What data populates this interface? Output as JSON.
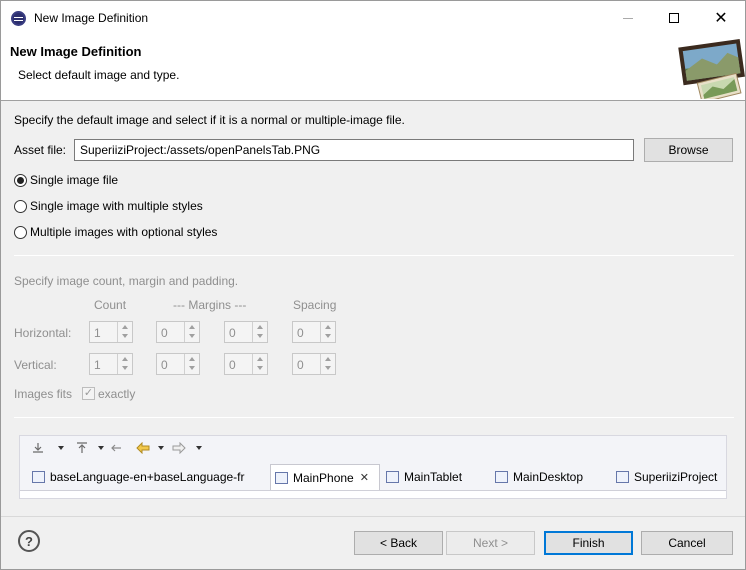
{
  "window": {
    "title": "New Image Definition",
    "icon": "eclipse-icon"
  },
  "header": {
    "title": "New Image Definition",
    "description": "Select default image and type.",
    "image": "image-definition-banner-icon"
  },
  "instructions": "Specify the default image and select if it is a normal or multiple-image file.",
  "asset": {
    "label": "Asset file:",
    "value": "SuperiiziProject:/assets/openPanelsTab.PNG",
    "browse_label": "Browse"
  },
  "type_options": [
    {
      "label": "Single image file",
      "checked": true
    },
    {
      "label": "Single image with multiple styles",
      "checked": false
    },
    {
      "label": "Multiple images with optional styles",
      "checked": false
    }
  ],
  "count_section": {
    "instructions": "Specify image count, margin and padding.",
    "col_count": "Count",
    "col_margins": "--- Margins ---",
    "col_spacing": "Spacing",
    "horizontal_label": "Horizontal:",
    "vertical_label": "Vertical:",
    "horizontal": [
      "1",
      "0",
      "0",
      "0"
    ],
    "vertical": [
      "1",
      "0",
      "0",
      "0"
    ],
    "fits_label": "Images fits",
    "exactly_label": "exactly",
    "exactly_checked": true
  },
  "editor": {
    "tabs": [
      {
        "label": "baseLanguage-en+baseLanguage-fr",
        "active": false
      },
      {
        "label": "MainPhone",
        "active": true
      },
      {
        "label": "MainTablet",
        "active": false
      },
      {
        "label": "MainDesktop",
        "active": false
      },
      {
        "label": "SuperiiziProject",
        "active": false
      }
    ]
  },
  "footer": {
    "help": "?",
    "back_label": "< Back",
    "next_label": "Next >",
    "finish_label": "Finish",
    "cancel_label": "Cancel"
  }
}
